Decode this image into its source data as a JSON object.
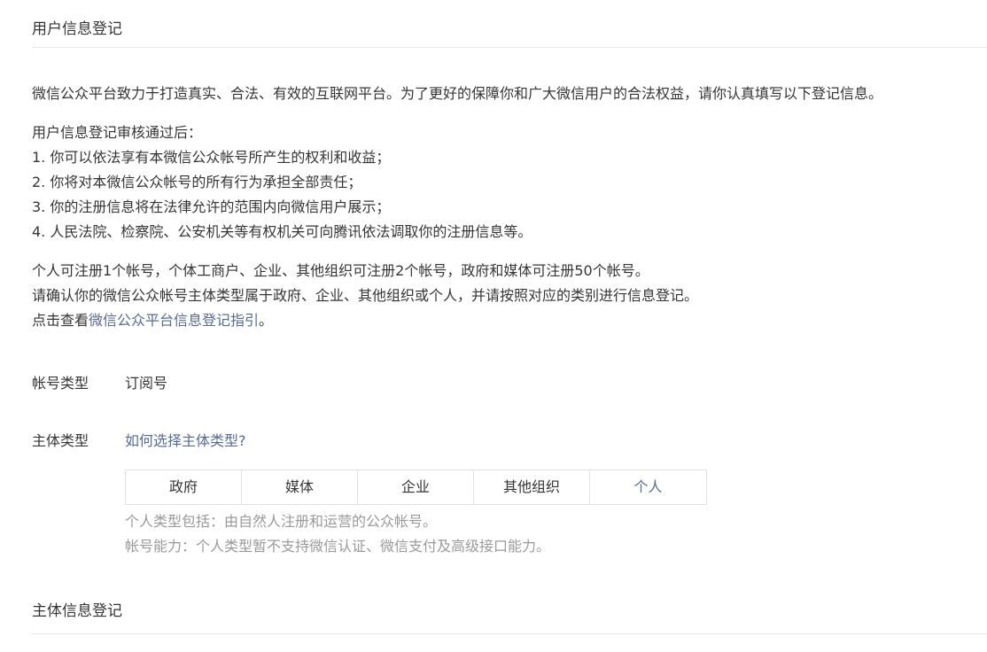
{
  "sections": {
    "user_info_title": "用户信息登记",
    "subject_info_title": "主体信息登记"
  },
  "notice": {
    "intro": "微信公众平台致力于打造真实、合法、有效的互联网平台。为了更好的保障你和广大微信用户的合法权益，请你认真填写以下登记信息。",
    "after_title": "用户信息登记审核通过后：",
    "items": [
      "1. 你可以依法享有本微信公众帐号所产生的权利和收益；",
      "2. 你将对本微信公众帐号的所有行为承担全部责任；",
      "3. 你的注册信息将在法律允许的范围内向微信用户展示；",
      "4. 人民法院、检察院、公安机关等有权机关可向腾讯依法调取你的注册信息等。"
    ],
    "quota": "个人可注册1个帐号，个体工商户、企业、其他组织可注册2个帐号，政府和媒体可注册50个帐号。",
    "confirm": "请确认你的微信公众帐号主体类型属于政府、企业、其他组织或个人，并请按照对应的类别进行信息登记。",
    "guide_prefix": "点击查看",
    "guide_link": "微信公众平台信息登记指引",
    "guide_suffix": "。"
  },
  "account_type": {
    "label": "帐号类型",
    "value": "订阅号"
  },
  "subject_type": {
    "label": "主体类型",
    "help_link": "如何选择主体类型?",
    "options": [
      "政府",
      "媒体",
      "企业",
      "其他组织",
      "个人"
    ],
    "selected": "个人",
    "tips": [
      "个人类型包括：由自然人注册和运营的公众帐号。",
      "帐号能力：个人类型暂不支持微信认证、微信支付及高级接口能力。"
    ]
  },
  "colors": {
    "link": "#576b95",
    "text": "#353535",
    "tip": "#9a9a9a",
    "border": "#e0e1e2"
  }
}
